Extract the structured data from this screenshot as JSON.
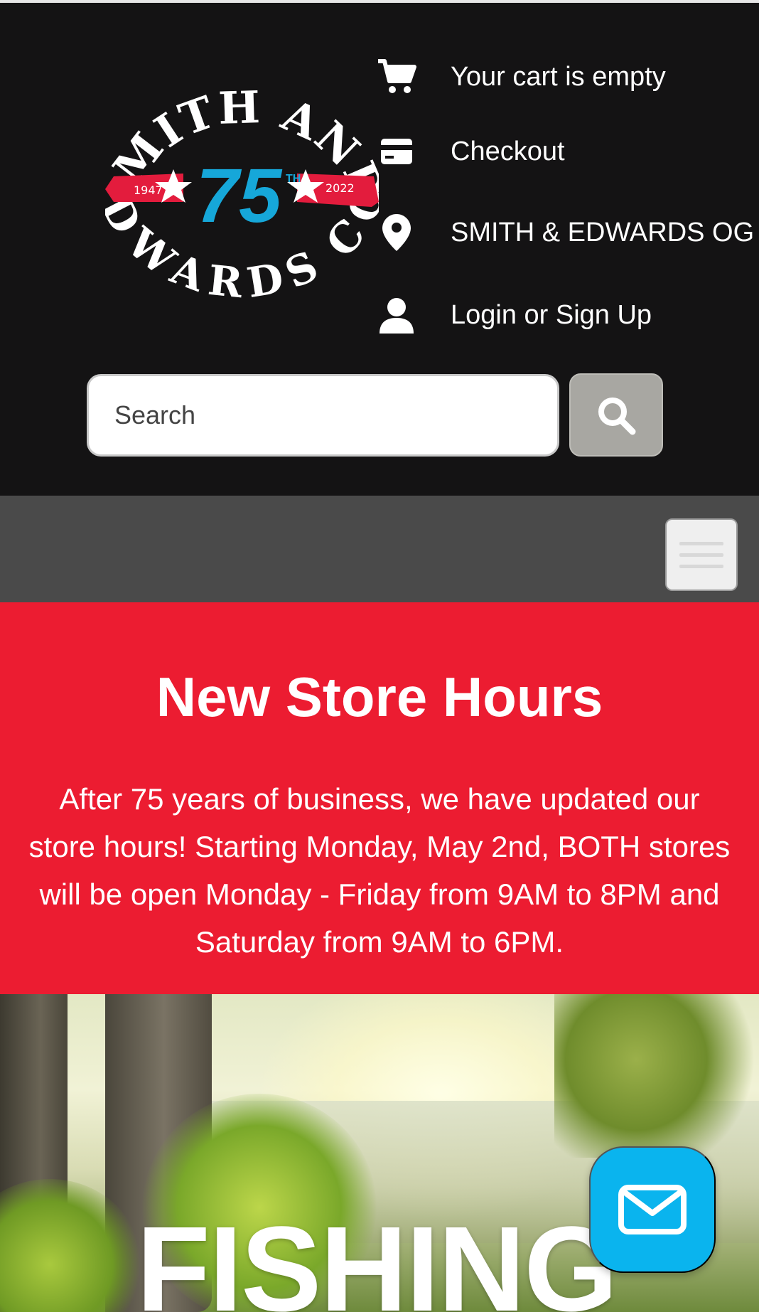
{
  "brand": {
    "logo_text_top": "SMITH AND",
    "logo_text_bottom": "EDWARDS CO.",
    "logo_number": "75",
    "logo_suffix": "TH",
    "logo_year_start": "1947",
    "logo_year_end": "2022",
    "colors": {
      "red": "#e31c3d",
      "blue": "#16a7d9",
      "white": "#ffffff"
    }
  },
  "header": {
    "cart": {
      "label": "Your cart is empty",
      "icon": "cart-icon"
    },
    "checkout": {
      "label": "Checkout",
      "icon": "credit-card-icon"
    },
    "store": {
      "label": "SMITH & EDWARDS OG",
      "icon": "map-pin-icon"
    },
    "account": {
      "label": "Login or Sign Up",
      "icon": "user-icon"
    },
    "search": {
      "placeholder": "Search",
      "button_icon": "search-icon"
    }
  },
  "nav": {
    "menu_icon": "hamburger-menu-icon"
  },
  "announcement": {
    "title": "New Store Hours",
    "body": "After 75 years of business, we have updated our store hours! Starting Monday, May 2nd, BOTH stores will be open Monday - Friday from 9AM to 8PM and Saturday from 9AM to 6PM.",
    "background": "#ec1c31"
  },
  "hero": {
    "title": "FISHING"
  },
  "chat": {
    "icon": "envelope-icon",
    "color": "#0ab4ee"
  }
}
